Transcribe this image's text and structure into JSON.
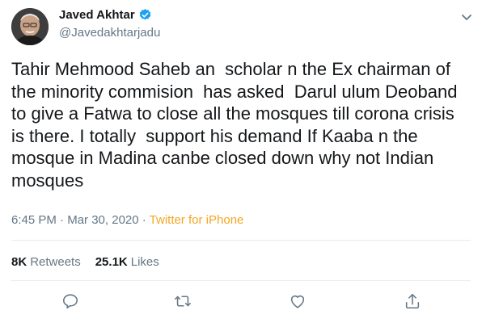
{
  "author": {
    "name": "Javed Akhtar",
    "handle": "@Javedakhtarjadu",
    "verified_icon": "verified-badge-icon",
    "verified_color": "#1da1f2"
  },
  "tweet": {
    "lines": [
      "Tahir Mehmood Saheb an  scholar n the Ex chairman of",
      "the minority commision  has asked  Darul ulum Deoband",
      "to give a Fatwa to close all the mosques till corona crisis",
      "is there. I totally  support his demand If Kaaba n the",
      "mosque in Madina canbe closed down why not Indian",
      "mosques"
    ],
    "time": "6:45 PM",
    "separator": " · ",
    "date": "Mar 30, 2020",
    "source": "Twitter for iPhone",
    "source_color": "#f5a623"
  },
  "stats": {
    "retweets_count": "8K",
    "retweets_label": "Retweets",
    "likes_count": "25.1K",
    "likes_label": "Likes"
  },
  "actions": {
    "reply_icon": "reply-icon",
    "retweet_icon": "retweet-icon",
    "like_icon": "heart-icon",
    "share_icon": "share-icon"
  }
}
